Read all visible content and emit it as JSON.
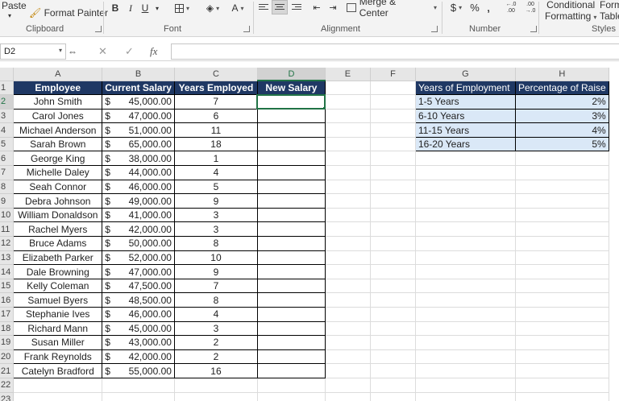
{
  "ribbon": {
    "paste_label": "Paste",
    "format_painter_label": "Format Painter",
    "bold": "B",
    "italic": "I",
    "underline": "U",
    "font_color": "A",
    "merge_center_label": "Merge & Center",
    "currency_symbol": "$",
    "percent_symbol": "%",
    "comma_symbol": "‚",
    "increase_decimal": "←.0 .00",
    "decrease_decimal": ".00 →.0",
    "conditional_formatting_line1": "Conditional",
    "conditional_formatting_line2": "Formatting",
    "format_as_table_line1": "Forma",
    "format_as_table_line2": "Table",
    "groups": {
      "clipboard": "Clipboard",
      "font": "Font",
      "alignment": "Alignment",
      "number": "Number",
      "styles": "Styles"
    }
  },
  "formula_bar": {
    "name_box": "D2",
    "cancel_icon": "✕",
    "enter_icon": "✓",
    "fx_label": "fx",
    "content": ""
  },
  "columns": [
    "A",
    "B",
    "C",
    "D",
    "E",
    "F",
    "G",
    "H"
  ],
  "row_numbers": [
    "1",
    "2",
    "3",
    "4",
    "5",
    "6",
    "7",
    "8",
    "9",
    "10",
    "11",
    "12",
    "13",
    "14",
    "15",
    "16",
    "17",
    "18",
    "19",
    "20",
    "21",
    "22",
    "23"
  ],
  "headers": {
    "employee": "Employee",
    "current_salary": "Current Salary",
    "years_employed": "Years Employed",
    "new_salary": "New Salary"
  },
  "employees": [
    {
      "name": "John Smith",
      "salary": "45,000.00",
      "years": "7"
    },
    {
      "name": "Carol Jones",
      "salary": "47,000.00",
      "years": "6"
    },
    {
      "name": "Michael Anderson",
      "salary": "51,000.00",
      "years": "11"
    },
    {
      "name": "Sarah Brown",
      "salary": "65,000.00",
      "years": "18"
    },
    {
      "name": "George King",
      "salary": "38,000.00",
      "years": "1"
    },
    {
      "name": "Michelle Daley",
      "salary": "44,000.00",
      "years": "4"
    },
    {
      "name": "Seah Connor",
      "salary": "46,000.00",
      "years": "5"
    },
    {
      "name": "Debra Johnson",
      "salary": "49,000.00",
      "years": "9"
    },
    {
      "name": "William Donaldson",
      "salary": "41,000.00",
      "years": "3"
    },
    {
      "name": "Rachel Myers",
      "salary": "42,000.00",
      "years": "3"
    },
    {
      "name": "Bruce Adams",
      "salary": "50,000.00",
      "years": "8"
    },
    {
      "name": "Elizabeth Parker",
      "salary": "52,000.00",
      "years": "10"
    },
    {
      "name": "Dale Browning",
      "salary": "47,000.00",
      "years": "9"
    },
    {
      "name": "Kelly Coleman",
      "salary": "47,500.00",
      "years": "7"
    },
    {
      "name": "Samuel Byers",
      "salary": "48,500.00",
      "years": "8"
    },
    {
      "name": "Stephanie Ives",
      "salary": "46,000.00",
      "years": "4"
    },
    {
      "name": "Richard Mann",
      "salary": "45,000.00",
      "years": "3"
    },
    {
      "name": "Susan Miller",
      "salary": "43,000.00",
      "years": "2"
    },
    {
      "name": "Frank Reynolds",
      "salary": "42,000.00",
      "years": "2"
    },
    {
      "name": "Catelyn Bradford",
      "salary": "55,000.00",
      "years": "16"
    }
  ],
  "currency_symbol": "$",
  "raise_table": {
    "header_years": "Years of Employment",
    "header_pct": "Percentage of Raise",
    "rows": [
      {
        "range": "1-5 Years",
        "pct": "2%"
      },
      {
        "range": "6-10 Years",
        "pct": "3%"
      },
      {
        "range": "11-15 Years",
        "pct": "4%"
      },
      {
        "range": "16-20 Years",
        "pct": "5%"
      }
    ]
  },
  "colors": {
    "header_fill": "#1f3864",
    "raise_row_fill": "#dae8f7",
    "excel_green": "#217346"
  },
  "icons": [
    "format-painter-icon",
    "borders-icon",
    "fill-color-icon",
    "merge-center-icon",
    "align-left-icon",
    "align-center-icon",
    "align-right-icon",
    "decrease-indent-icon",
    "increase-indent-icon",
    "dialog-launcher-icon"
  ]
}
